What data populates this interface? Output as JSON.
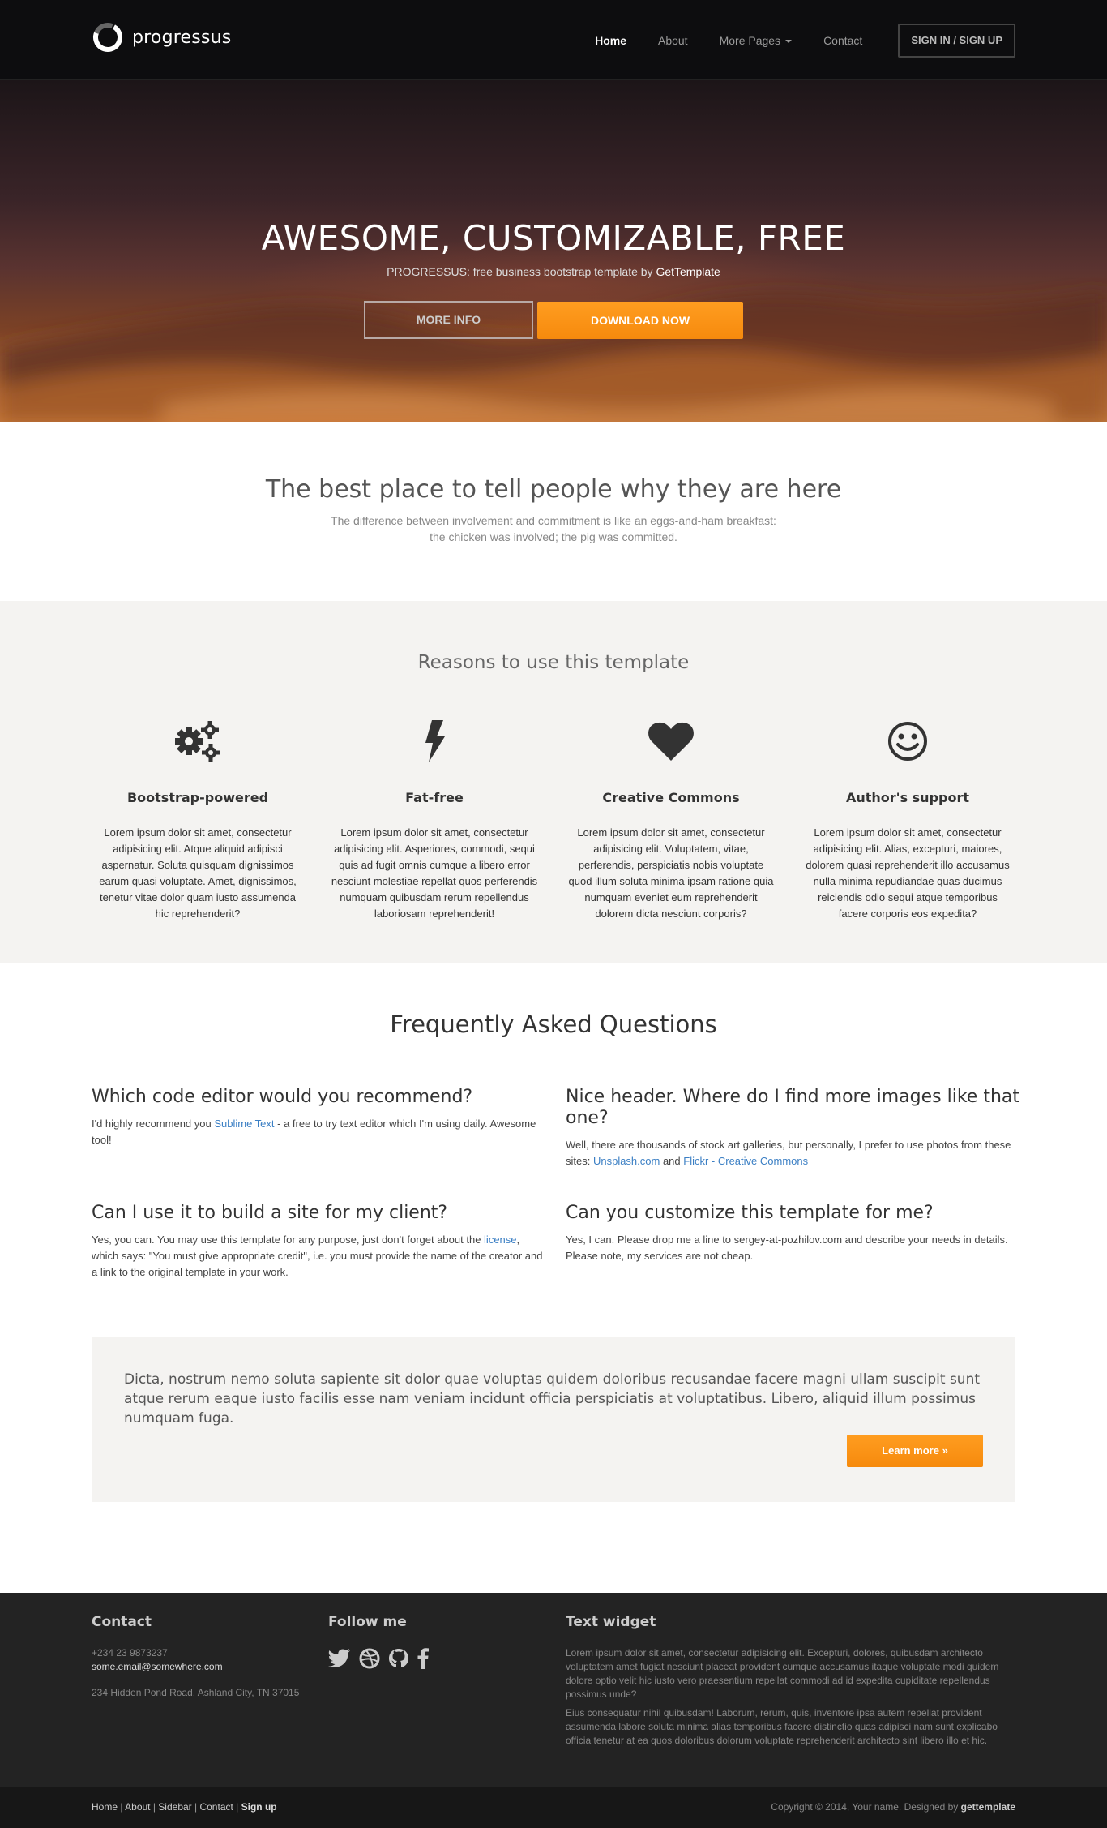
{
  "brand": {
    "name": "progressus"
  },
  "nav": {
    "items": [
      {
        "label": "Home"
      },
      {
        "label": "About"
      },
      {
        "label": "More Pages"
      },
      {
        "label": "Contact"
      }
    ],
    "signin_label": "SIGN IN / SIGN UP"
  },
  "hero": {
    "title": "AWESOME, CUSTOMIZABLE, FREE",
    "subtitle_prefix": "PROGRESSUS: free business bootstrap template by ",
    "subtitle_link": "GetTemplate",
    "more_info_label": "MORE INFO",
    "download_label": "DOWNLOAD NOW"
  },
  "intro": {
    "heading": "The best place to tell people why they are here",
    "line1": "The difference between involvement and commitment is like an eggs-and-ham breakfast:",
    "line2": "the chicken was involved; the pig was committed."
  },
  "reasons": {
    "heading": "Reasons to use this template",
    "features": [
      {
        "icon": "gears-icon",
        "title": "Bootstrap-powered",
        "text": "Lorem ipsum dolor sit amet, consectetur adipisicing elit. Atque aliquid adipisci aspernatur. Soluta quisquam dignissimos earum quasi voluptate. Amet, dignissimos, tenetur vitae dolor quam iusto assumenda hic reprehenderit?"
      },
      {
        "icon": "lightning-icon",
        "title": "Fat-free",
        "text": "Lorem ipsum dolor sit amet, consectetur adipisicing elit. Asperiores, commodi, sequi quis ad fugit omnis cumque a libero error nesciunt molestiae repellat quos perferendis numquam quibusdam rerum repellendus laboriosam reprehenderit!"
      },
      {
        "icon": "heart-icon",
        "title": "Creative Commons",
        "text": "Lorem ipsum dolor sit amet, consectetur adipisicing elit. Voluptatem, vitae, perferendis, perspiciatis nobis voluptate quod illum soluta minima ipsam ratione quia numquam eveniet eum reprehenderit dolorem dicta nesciunt corporis?"
      },
      {
        "icon": "smile-icon",
        "title": "Author's support",
        "text": "Lorem ipsum dolor sit amet, consectetur adipisicing elit. Alias, excepturi, maiores, dolorem quasi reprehenderit illo accusamus nulla minima repudiandae quas ducimus reiciendis odio sequi atque temporibus facere corporis eos expedita?"
      }
    ]
  },
  "faq": {
    "heading": "Frequently Asked Questions",
    "q1": {
      "title": "Which code editor would you recommend?",
      "pre": "I'd highly recommend you ",
      "link": "Sublime Text",
      "post": " - a free to try text editor which I'm using daily. Awesome tool!"
    },
    "q2": {
      "title": "Nice header. Where do I find more images like that one?",
      "pre": "Well, there are thousands of stock art galleries, but personally, I prefer to use photos from these sites: ",
      "link1": "Unsplash.com",
      "mid": " and ",
      "link2": "Flickr - Creative Commons"
    },
    "q3": {
      "title": "Can I use it to build a site for my client?",
      "pre": "Yes, you can. You may use this template for any purpose, just don't forget about the ",
      "link": "license",
      "post": ", which says: \"You must give appropriate credit\", i.e. you must provide the name of the creator and a link to the original template in your work."
    },
    "q4": {
      "title": "Can you customize this template for me?",
      "text": "Yes, I can. Please drop me a line to sergey-at-pozhilov.com and describe your needs in details. Please note, my services are not cheap."
    }
  },
  "cta": {
    "text": "Dicta, nostrum nemo soluta sapiente sit dolor quae voluptas quidem doloribus recusandae facere magni ullam suscipit sunt atque rerum eaque iusto facilis esse nam veniam incidunt officia perspiciatis at voluptatibus. Libero, aliquid illum possimus numquam fuga.",
    "button_label": "Learn more »"
  },
  "footer": {
    "contact": {
      "heading": "Contact",
      "phone": "+234 23 9873237",
      "email": "some.email@somewhere.com",
      "address": "234 Hidden Pond Road, Ashland City, TN 37015"
    },
    "follow": {
      "heading": "Follow me",
      "icons": [
        "twitter-icon",
        "dribbble-icon",
        "github-icon",
        "facebook-icon"
      ]
    },
    "widget": {
      "heading": "Text widget",
      "p1": "Lorem ipsum dolor sit amet, consectetur adipisicing elit. Excepturi, dolores, quibusdam architecto voluptatem amet fugiat nesciunt placeat provident cumque accusamus itaque voluptate modi quidem dolore optio velit hic iusto vero praesentium repellat commodi ad id expedita cupiditate repellendus possimus unde?",
      "p2": "Eius consequatur nihil quibusdam! Laborum, rerum, quis, inventore ipsa autem repellat provident assumenda labore soluta minima alias temporibus facere distinctio quas adipisci nam sunt explicabo officia tenetur at ea quos doloribus dolorum voluptate reprehenderit architecto sint libero illo et hic."
    }
  },
  "subfooter": {
    "links": [
      "Home",
      "About",
      "Sidebar",
      "Contact",
      "Sign up"
    ],
    "copy_prefix": "Copyright © 2014, Your name. Designed by ",
    "copy_brand": "gettemplate"
  }
}
